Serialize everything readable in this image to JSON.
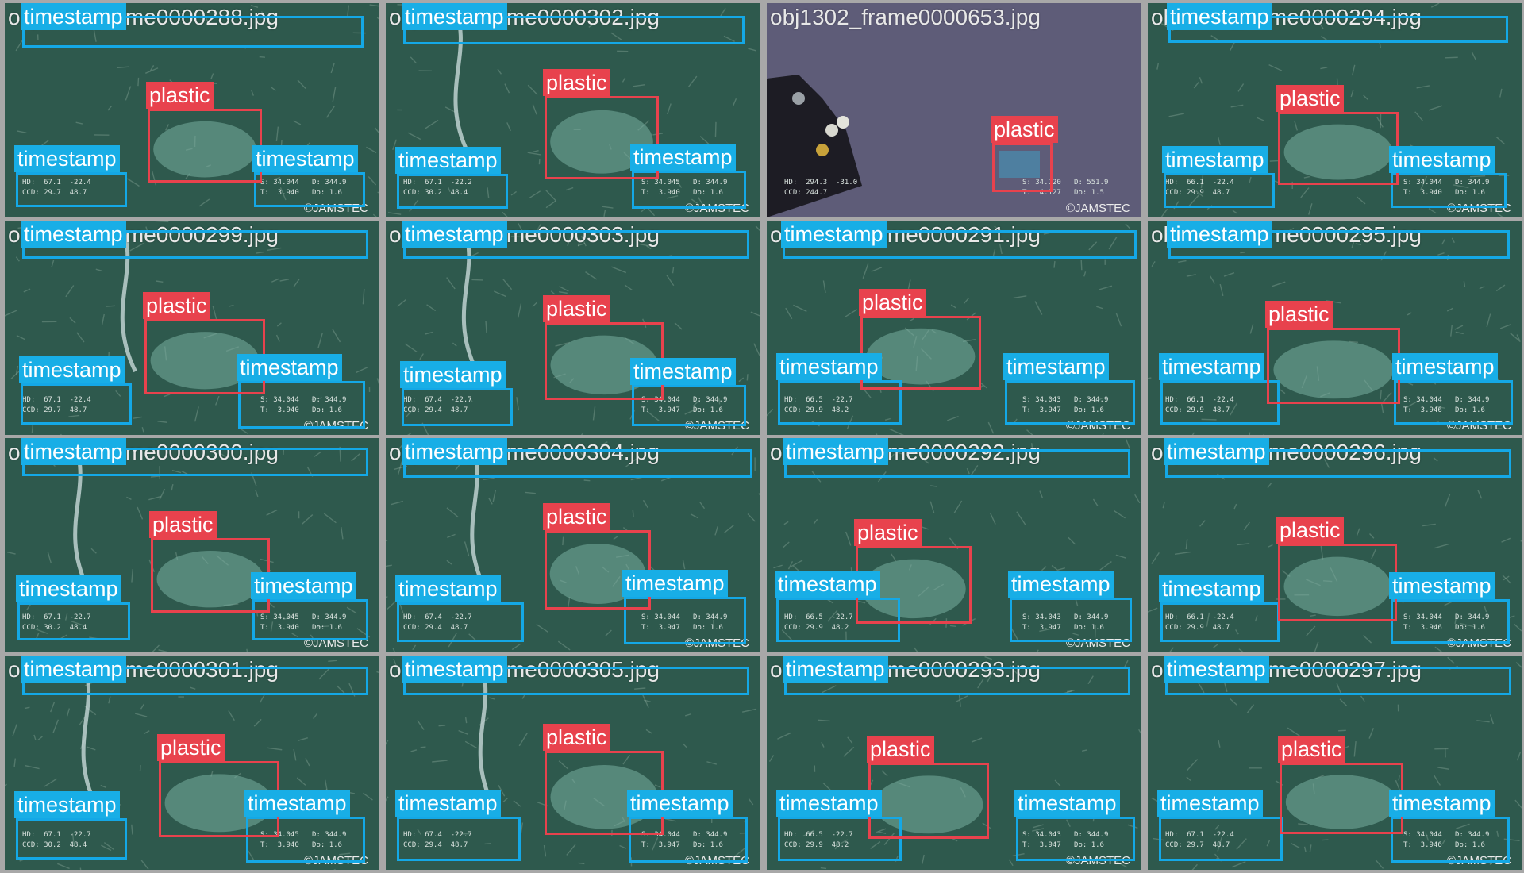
{
  "copyright": "©JAMSTEC",
  "colors": {
    "plastic_box": "#e8424d",
    "timestamp_box": "#14a8e6",
    "seafloor": "#2f5a4e",
    "deep_water": "#5c5a76"
  },
  "labels": {
    "plastic": "plastic",
    "timestamp": "timestamp"
  },
  "tiles": [
    {
      "name": "obj1314_frame0000288.jpg",
      "hud_left": "HD:  67.1  -22.4\nCCD: 29.7  48.7",
      "hud_right": "S: 34.044   D: 344.9\nT:  3.940   Do: 1.6"
    },
    {
      "name": "obj1314_frame0000302.jpg",
      "hud_left": "HD:  67.1  -22.2\nCCD: 30.2  48.4",
      "hud_right": "S: 34.045   D: 344.9\nT:  3.940   Do: 1.6"
    },
    {
      "name": "obj1302_frame0000653.jpg",
      "hud_left": "HD:  294.3  -31.0\nCCD: 244.7",
      "hud_right": "S: 34.120   D: 551.9\nT:  4.127   Do: 1.5"
    },
    {
      "name": "obj1314_frame0000294.jpg",
      "hud_left": "HD:  66.1  -22.4\nCCD: 29.9  48.7",
      "hud_right": "S: 34.044   D: 344.9\nT:  3.940   Do: 1.6"
    },
    {
      "name": "obj1314_frame0000299.jpg",
      "hud_left": "HD:  67.1  -22.4\nCCD: 29.7  48.7",
      "hud_right": "S: 34.044   D: 344.9\nT:  3.940   Do: 1.6"
    },
    {
      "name": "obj1314_frame0000303.jpg",
      "hud_left": "HD:  67.4  -22.7\nCCD: 29.4  48.7",
      "hud_right": "S: 34.044   D: 344.9\nT:  3.947   Do: 1.6"
    },
    {
      "name": "obj1314_frame0000291.jpg",
      "hud_left": "HD:  66.5  -22.7\nCCD: 29.9  48.2",
      "hud_right": "S: 34.043   D: 344.9\nT:  3.947   Do: 1.6"
    },
    {
      "name": "obj1314_frame0000295.jpg",
      "hud_left": "HD:  66.1  -22.4\nCCD: 29.9  48.7",
      "hud_right": "S: 34.044   D: 344.9\nT:  3.946   Do: 1.6"
    },
    {
      "name": "obj1314_frame0000300.jpg",
      "hud_left": "HD:  67.1  -22.7\nCCD: 30.2  48.4",
      "hud_right": "S: 34.045   D: 344.9\nT:  3.940   Do: 1.6"
    },
    {
      "name": "obj1314_frame0000304.jpg",
      "hud_left": "HD:  67.4  -22.7\nCCD: 29.4  48.7",
      "hud_right": "S: 34.044   D: 344.9\nT:  3.947   Do: 1.6"
    },
    {
      "name": "obj1314_frame0000292.jpg",
      "hud_left": "HD:  66.5  -22.7\nCCD: 29.9  48.2",
      "hud_right": "S: 34.043   D: 344.9\nT:  3.947   Do: 1.6"
    },
    {
      "name": "obj1314_frame0000296.jpg",
      "hud_left": "HD:  66.1  -22.4\nCCD: 29.9  48.7",
      "hud_right": "S: 34.044   D: 344.9\nT:  3.946   Do: 1.6"
    },
    {
      "name": "obj1314_frame0000301.jpg",
      "hud_left": "HD:  67.1  -22.7\nCCD: 30.2  48.4",
      "hud_right": "S: 34.045   D: 344.9\nT:  3.940   Do: 1.6"
    },
    {
      "name": "obj1314_frame0000305.jpg",
      "hud_left": "HD:  67.4  -22.7\nCCD: 29.4  48.7",
      "hud_right": "S: 34.044   D: 344.9\nT:  3.947   Do: 1.6"
    },
    {
      "name": "obj1314_frame0000293.jpg",
      "hud_left": "HD:  66.5  -22.7\nCCD: 29.9  48.2",
      "hud_right": "S: 34.043   D: 344.9\nT:  3.947   Do: 1.6"
    },
    {
      "name": "obj1314_frame0000297.jpg",
      "hud_left": "HD:  67.1  -22.4\nCCD: 29.7  48.7",
      "hud_right": "S: 34.044   D: 344.9\nT:  3.946   Do: 1.6"
    }
  ]
}
